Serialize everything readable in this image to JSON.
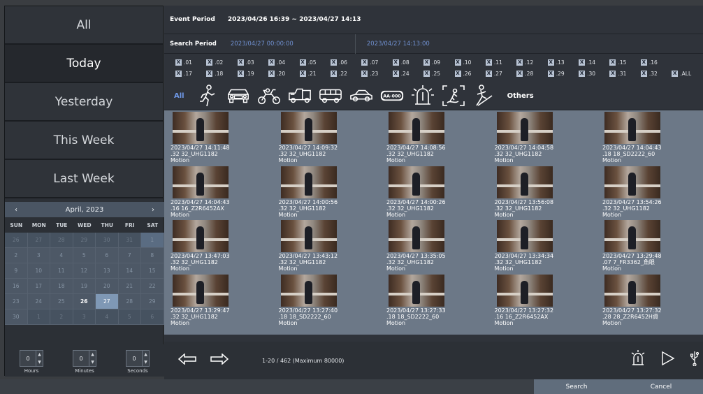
{
  "quick_periods": [
    "All",
    "Today",
    "Yesterday",
    "This Week",
    "Last Week"
  ],
  "selected_period": "Today",
  "calendar": {
    "month_label": "April, 2023",
    "prev_icon": "‹",
    "next_icon": "›",
    "weekdays": [
      "SUN",
      "MON",
      "TUE",
      "WED",
      "THU",
      "FRI",
      "SAT"
    ],
    "days": [
      [
        "26",
        "27",
        "28",
        "29",
        "30",
        "31",
        "1"
      ],
      [
        "2",
        "3",
        "4",
        "5",
        "6",
        "7",
        "8"
      ],
      [
        "9",
        "10",
        "11",
        "12",
        "13",
        "14",
        "15"
      ],
      [
        "16",
        "17",
        "18",
        "19",
        "20",
        "21",
        "22"
      ],
      [
        "23",
        "24",
        "25",
        "26",
        "27",
        "28",
        "29"
      ],
      [
        "30",
        "1",
        "2",
        "3",
        "4",
        "5",
        "6"
      ]
    ],
    "selected_day": "27",
    "today_day": "26"
  },
  "time": {
    "hours": "0",
    "minutes": "0",
    "seconds": "0",
    "hours_label": "Hours",
    "minutes_label": "Minutes",
    "seconds_label": "Seconds"
  },
  "event_period": {
    "label": "Event Period",
    "value": "2023/04/26 16:39 ~ 2023/04/27 14:13"
  },
  "search_period": {
    "label": "Search Period",
    "from": "2023/04/27 00:00:00",
    "to": "2023/04/27 14:13:00"
  },
  "channels": [
    [
      ".01",
      ".02",
      ".03",
      ".04",
      ".05",
      ".06",
      ".07",
      ".08",
      ".09",
      ".10",
      ".11",
      ".12",
      ".13",
      ".14",
      ".15",
      ".16"
    ],
    [
      ".17",
      ".18",
      ".19",
      ".20",
      ".21",
      ".22",
      ".23",
      ".24",
      ".25",
      ".26",
      ".27",
      ".28",
      ".29",
      ".30",
      ".31",
      ".32",
      ".ALL"
    ]
  ],
  "filters": {
    "all_label": "All",
    "icons": [
      "pedestrian-icon",
      "car-icon",
      "motorcycle-icon",
      "truck-icon",
      "bus-icon",
      "sedan-icon",
      "license-plate-icon",
      "alarm-icon",
      "loitering-icon",
      "falling-person-icon"
    ],
    "plate_text": "AA-000",
    "others_label": "Others"
  },
  "results": [
    {
      "time": "2023/04/27 14:11:48",
      "cam": ".32 32_UHG1182",
      "type": "Motion"
    },
    {
      "time": "2023/04/27 14:09:32",
      "cam": ".32 32_UHG1182",
      "type": "Motion"
    },
    {
      "time": "2023/04/27 14:08:56",
      "cam": ".32 32_UHG1182",
      "type": "Motion"
    },
    {
      "time": "2023/04/27 14:04:58",
      "cam": ".32 32_UHG1182",
      "type": "Motion"
    },
    {
      "time": "2023/04/27 14:04:43",
      "cam": ".18 18_SD2222_60",
      "type": "Motion"
    },
    {
      "time": "2023/04/27 14:04:43",
      "cam": ".16 16_Z2R6452AX",
      "type": "Motion"
    },
    {
      "time": "2023/04/27 14:00:56",
      "cam": ".32 32_UHG1182",
      "type": "Motion"
    },
    {
      "time": "2023/04/27 14:00:26",
      "cam": ".32 32_UHG1182",
      "type": "Motion"
    },
    {
      "time": "2023/04/27 13:56:08",
      "cam": ".32 32_UHG1182",
      "type": "Motion"
    },
    {
      "time": "2023/04/27 13:54:26",
      "cam": ".32 32_UHG1182",
      "type": "Motion"
    },
    {
      "time": "2023/04/27 13:47:03",
      "cam": ".32 32_UHG1182",
      "type": "Motion"
    },
    {
      "time": "2023/04/27 13:43:12",
      "cam": ".32 32_UHG1182",
      "type": "Motion"
    },
    {
      "time": "2023/04/27 13:35:05",
      "cam": ".32 32_UHG1182",
      "type": "Motion"
    },
    {
      "time": "2023/04/27 13:34:34",
      "cam": ".32 32_UHG1182",
      "type": "Motion"
    },
    {
      "time": "2023/04/27 13:29:48",
      "cam": ".07 7_FR3362_魚眼",
      "type": "Motion"
    },
    {
      "time": "2023/04/27 13:29:47",
      "cam": ".32 32_UHG1182",
      "type": "Motion"
    },
    {
      "time": "2023/04/27 13:27:40",
      "cam": ".18 18_SD2222_60",
      "type": "Motion"
    },
    {
      "time": "2023/04/27 13:27:33",
      "cam": ".18 18_SD2222_60",
      "type": "Motion"
    },
    {
      "time": "2023/04/27 13:27:32",
      "cam": ".16 16_Z2R6452AX",
      "type": "Motion"
    },
    {
      "time": "2023/04/27 13:27:32",
      "cam": ".28 28_Z2R6452H資",
      "type": "Motion"
    }
  ],
  "pagination": "1-20 / 462 (Maximum 80000)",
  "footer_icons": [
    "prev-page-icon",
    "next-page-icon",
    "alarm-icon",
    "play-icon",
    "usb-icon"
  ],
  "buttons": {
    "search": "Search",
    "cancel": "Cancel"
  },
  "colors": {
    "accent": "#6f8fce",
    "selected_day": "#7f98b5",
    "thumb_bg": "#6c7887"
  }
}
